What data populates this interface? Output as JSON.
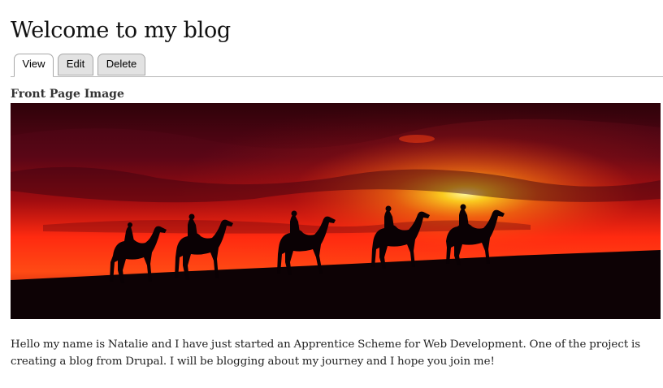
{
  "page": {
    "title": "Welcome to my blog"
  },
  "tabs": [
    {
      "label": "View",
      "active": true
    },
    {
      "label": "Edit",
      "active": false
    },
    {
      "label": "Delete",
      "active": false
    }
  ],
  "field": {
    "label": "Front Page Image"
  },
  "content": {
    "body": "Hello my name is Natalie and I have just started an Apprentice Scheme for Web Development.  One of the project is creating a blog from Drupal.  I will be blogging about my journey and I hope you join me!"
  },
  "colors": {
    "sky_top": "#5a0616",
    "sky_glow": "#ff2a10",
    "sun": "#fff24a",
    "ground": "#0d0205",
    "tab_border": "#a8a8a8",
    "tab_inactive_bg": "#e2e2e2"
  }
}
